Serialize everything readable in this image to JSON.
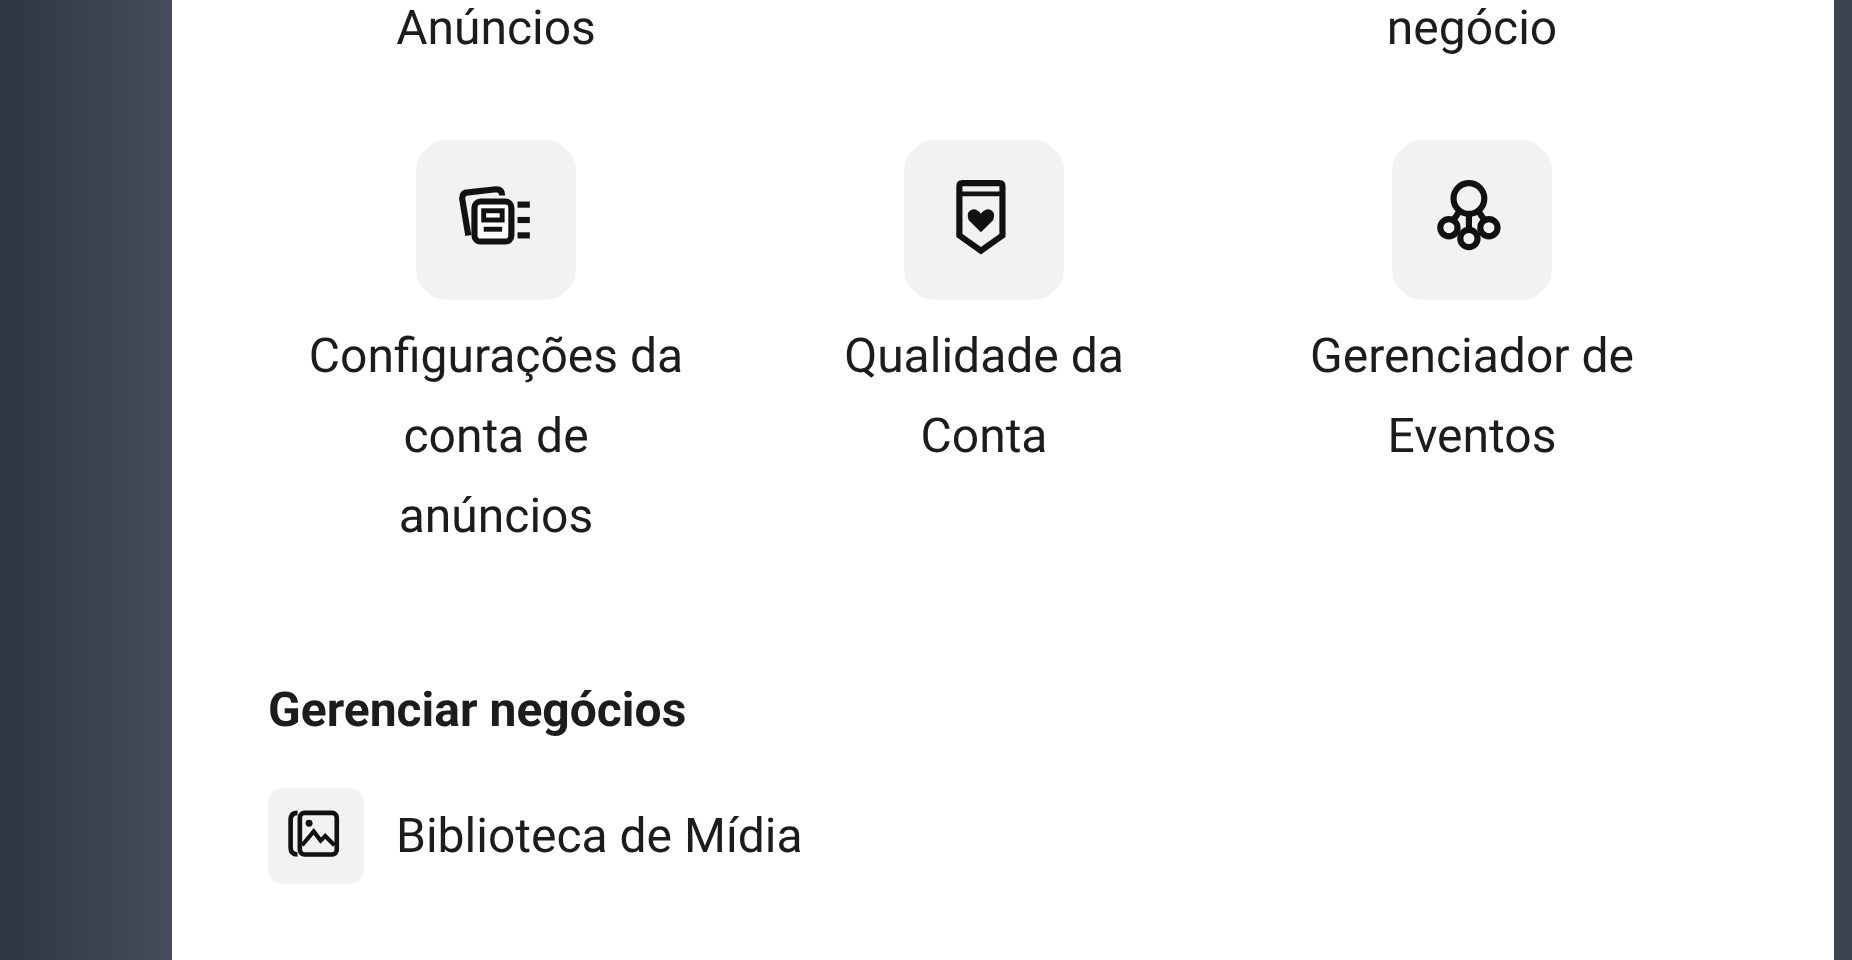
{
  "top_row": {
    "column_1": "Anúncios",
    "column_3": "negócio"
  },
  "tools": [
    {
      "kind": "ad-settings",
      "label": "Configurações da conta de anúncios"
    },
    {
      "kind": "account-quality",
      "label": "Qualidade da Conta"
    },
    {
      "kind": "events",
      "label": "Gerenciador de Eventos"
    }
  ],
  "section": {
    "title": "Gerenciar negócios",
    "items": [
      {
        "kind": "media",
        "label": "Biblioteca de Mídia"
      }
    ]
  }
}
